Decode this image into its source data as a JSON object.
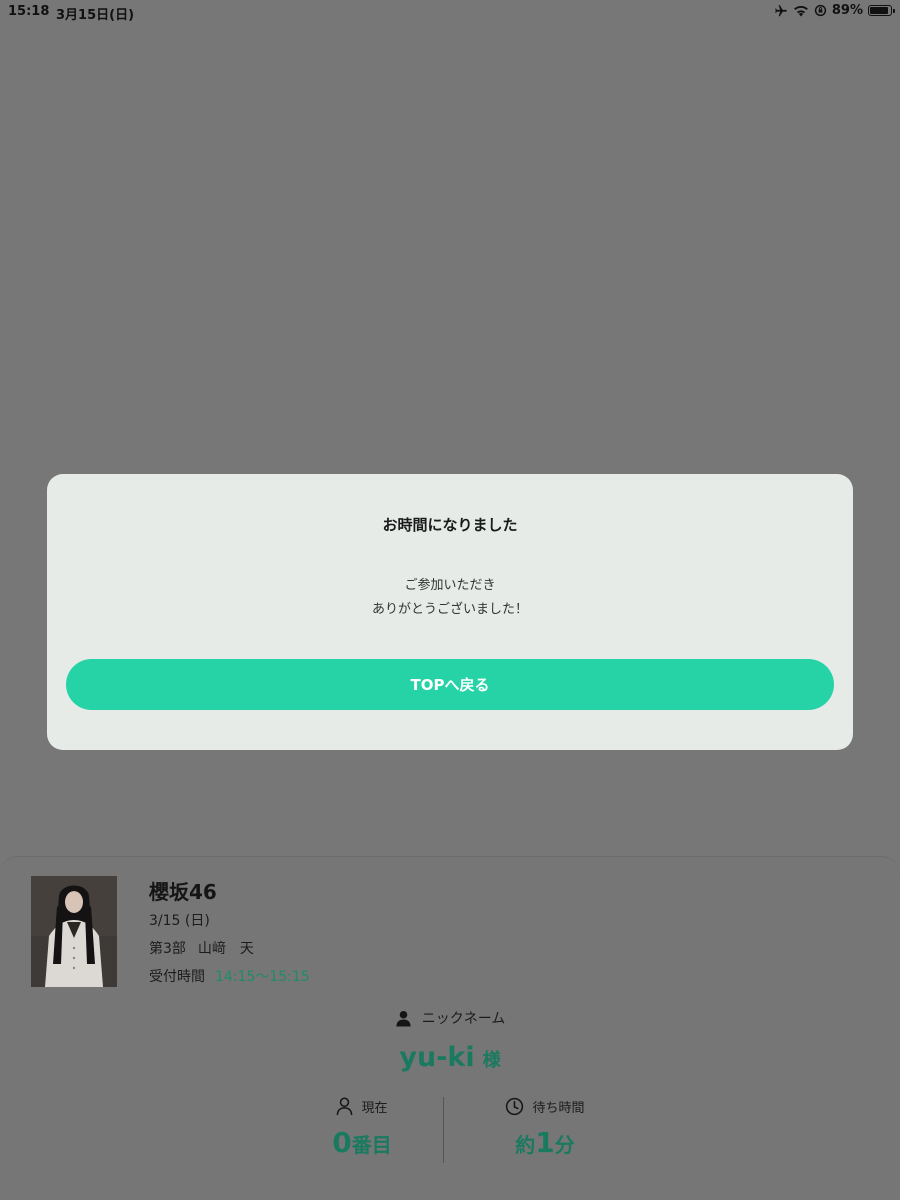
{
  "status_bar": {
    "time": "15:18",
    "date": "3月15日(日)",
    "battery": "89%",
    "battery_level": 0.89,
    "icons": [
      "airplane-icon",
      "wifi-icon",
      "orientation-lock-icon",
      "battery-icon"
    ]
  },
  "modal": {
    "title": "お時間になりました",
    "message_line1": "ご参加いただき",
    "message_line2": "ありがとうございました！",
    "button_label": "TOPへ戻る"
  },
  "ticket": {
    "group_name": "櫻坂46",
    "date": "3/15 (日)",
    "session": "第3部",
    "member": "山﨑　天",
    "reception_label": "受付時間",
    "reception_time": "14:15〜15:15",
    "nickname_label": "ニックネーム",
    "nickname": "yu-ki",
    "honorific": "様",
    "current_label": "現在",
    "current_number": "0",
    "current_unit": "番目",
    "wait_label": "待ち時間",
    "wait_prefix": "約",
    "wait_number": "1",
    "wait_unit": "分"
  },
  "colors": {
    "accent": "#25d3a6",
    "accent_text": "#1a7a5f",
    "overlay_bg": "#777777",
    "modal_bg": "#e6ebe8"
  }
}
